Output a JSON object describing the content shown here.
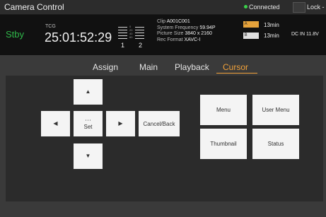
{
  "window": {
    "title": "Camera Control",
    "connection": "Connected",
    "lock": "Lock -"
  },
  "status": {
    "mode": "Stby",
    "tc_label": "TCG",
    "timecode": "25:01:52:29",
    "meter": {
      "scale": [
        "0",
        "20",
        "40",
        "60"
      ],
      "ch1": "1",
      "ch2": "2"
    },
    "clip": {
      "clip_label": "Clip",
      "clip_value": "A001C001",
      "freq_label": "System Frequency",
      "freq_value": "59.94P",
      "size_label": "Picture Size",
      "size_value": "3840 x 2160",
      "format_label": "Rec Format",
      "format_value": "XAVC-I"
    },
    "media": [
      {
        "slot": "A",
        "time": "13min",
        "color": "#e5a23b"
      },
      {
        "slot": "B",
        "time": "13min",
        "color": "#e0e0e0"
      }
    ],
    "power": "DC IN 11.8V"
  },
  "tabs": [
    {
      "label": "Assign",
      "active": false
    },
    {
      "label": "Main",
      "active": false
    },
    {
      "label": "Playback",
      "active": false
    },
    {
      "label": "Cursor",
      "active": true
    }
  ],
  "cursor_pad": {
    "up_icon": "arrow-up-icon",
    "down_icon": "arrow-down-icon",
    "left_icon": "arrow-left-icon",
    "right_icon": "arrow-right-icon",
    "set_label": "Set",
    "cancel_back": "Cancel/Back"
  },
  "menu_buttons": {
    "menu": "Menu",
    "user_menu": "User Menu",
    "thumbnail": "Thumbnail",
    "status": "Status"
  },
  "colors": {
    "accent": "#f2a23a",
    "standby": "#2fb84a",
    "connected_dot": "#3ad24a"
  }
}
